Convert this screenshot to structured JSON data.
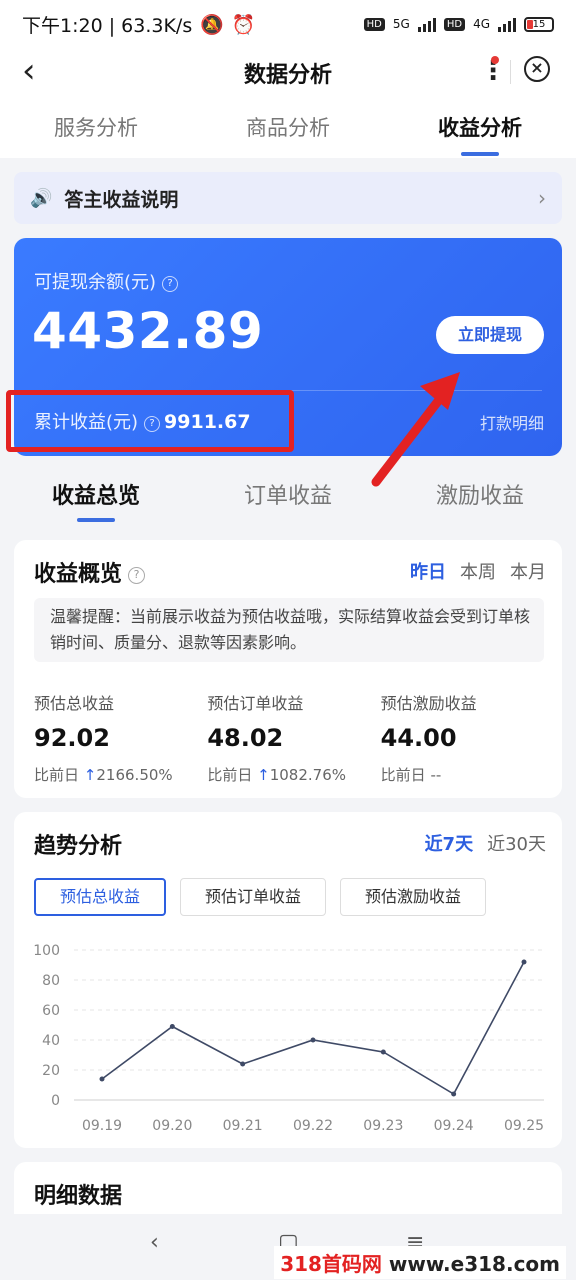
{
  "status_bar": {
    "time_speed": "下午1:20 | 63.3K/s",
    "net1": "5G",
    "net2": "4G",
    "battery": "15"
  },
  "header": {
    "title": "数据分析"
  },
  "top_tabs": [
    {
      "label": "服务分析"
    },
    {
      "label": "商品分析"
    },
    {
      "label": "收益分析"
    }
  ],
  "notice": {
    "text": "答主收益说明"
  },
  "balance": {
    "label": "可提现余额(元)",
    "amount": "4432.89",
    "withdraw_label": "立即提现",
    "cumulative_label": "累计收益(元)",
    "cumulative_value": "9911.67",
    "detail_link": "打款明细"
  },
  "sub_tabs": [
    {
      "label": "收益总览"
    },
    {
      "label": "订单收益"
    },
    {
      "label": "激励收益"
    }
  ],
  "overview": {
    "title": "收益概览",
    "ranges": [
      "昨日",
      "本周",
      "本月"
    ],
    "tip": "温馨提醒：当前展示收益为预估收益哦，实际结算收益会受到订单核销时间、质量分、退款等因素影响。",
    "metrics": [
      {
        "label": "预估总收益",
        "value": "92.02",
        "compare": "比前日",
        "change": "2166.50%"
      },
      {
        "label": "预估订单收益",
        "value": "48.02",
        "compare": "比前日",
        "change": "1082.76%"
      },
      {
        "label": "预估激励收益",
        "value": "44.00",
        "compare": "比前日",
        "change": "--"
      }
    ]
  },
  "trend": {
    "title": "趋势分析",
    "ranges": [
      "近7天",
      "近30天"
    ],
    "chips": [
      "预估总收益",
      "预估订单收益",
      "预估激励收益"
    ]
  },
  "chart_data": {
    "type": "line",
    "categories": [
      "09.19",
      "09.20",
      "09.21",
      "09.22",
      "09.23",
      "09.24",
      "09.25"
    ],
    "series": [
      {
        "values": [
          14,
          49,
          24,
          40,
          32,
          4,
          92
        ]
      }
    ],
    "ylim": [
      0,
      100
    ],
    "yticks": [
      0,
      20,
      40,
      60,
      80,
      100
    ],
    "grid": true,
    "color": "#3f4a66"
  },
  "details": {
    "title": "明细数据"
  },
  "watermark": {
    "brand": "318首码网",
    "url": "www.e318.com"
  }
}
